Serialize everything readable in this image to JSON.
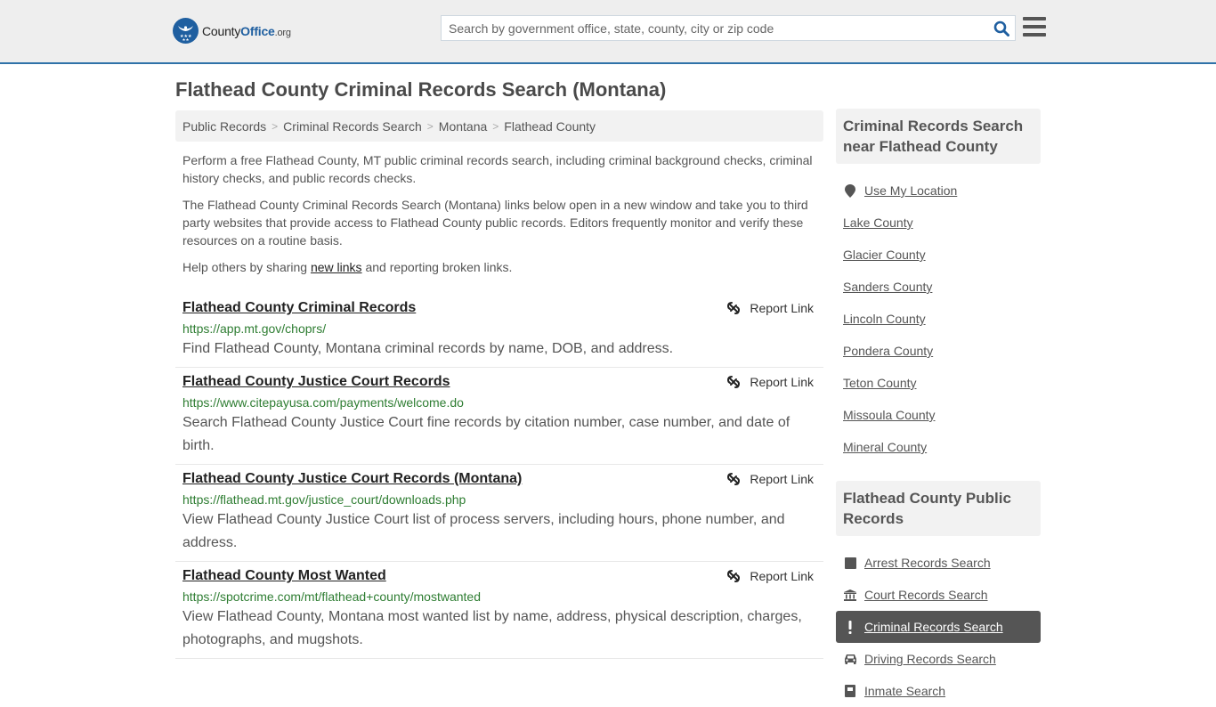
{
  "header": {
    "logo": {
      "prefix": "County",
      "brand": "Office",
      "tld": ".org"
    },
    "search": {
      "placeholder": "Search by government office, state, county, city or zip code",
      "value": ""
    },
    "icons": {
      "search": "search-icon",
      "menu": "hamburger-menu-icon"
    }
  },
  "page": {
    "title": "Flathead County Criminal Records Search (Montana)"
  },
  "breadcrumb": [
    "Public Records",
    "Criminal Records Search",
    "Montana",
    "Flathead County"
  ],
  "intro": {
    "p1": "Perform a free Flathead County, MT public criminal records search, including criminal background checks, criminal history checks, and public records checks.",
    "p2": "The Flathead County Criminal Records Search (Montana) links below open in a new window and take you to third party websites that provide access to Flathead County public records. Editors frequently monitor and verify these resources on a routine basis.",
    "p3_before": "Help others by sharing ",
    "p3_link": "new links",
    "p3_after": " and reporting broken links."
  },
  "records": [
    {
      "title": "Flathead County Criminal Records",
      "url": "https://app.mt.gov/choprs/",
      "description": "Find Flathead County, Montana criminal records by name, DOB, and address.",
      "report_label": "Report Link"
    },
    {
      "title": "Flathead County Justice Court Records",
      "url": "https://www.citepayusa.com/payments/welcome.do",
      "description": "Search Flathead County Justice Court fine records by citation number, case number, and date of birth.",
      "report_label": "Report Link"
    },
    {
      "title": "Flathead County Justice Court Records (Montana)",
      "url": "https://flathead.mt.gov/justice_court/downloads.php",
      "description": "View Flathead County Justice Court list of process servers, including hours, phone number, and address.",
      "report_label": "Report Link"
    },
    {
      "title": "Flathead County Most Wanted",
      "url": "https://spotcrime.com/mt/flathead+county/mostwanted",
      "description": "View Flathead County, Montana most wanted list by name, address, physical description, charges, photographs, and mugshots.",
      "report_label": "Report Link"
    }
  ],
  "sidebar": {
    "nearby": {
      "heading": "Criminal Records Search near Flathead County",
      "use_location": "Use My Location",
      "counties": [
        "Lake County",
        "Glacier County",
        "Sanders County",
        "Lincoln County",
        "Pondera County",
        "Teton County",
        "Missoula County",
        "Mineral County"
      ]
    },
    "public_records": {
      "heading": "Flathead County Public Records",
      "items": [
        {
          "label": "Arrest Records Search",
          "icon": "square-icon",
          "active": false
        },
        {
          "label": "Court Records Search",
          "icon": "courthouse-icon",
          "active": false
        },
        {
          "label": "Criminal Records Search",
          "icon": "exclamation-icon",
          "active": true
        },
        {
          "label": "Driving Records Search",
          "icon": "car-icon",
          "active": false
        },
        {
          "label": "Inmate Search",
          "icon": "inmate-icon",
          "active": false
        }
      ]
    }
  },
  "colors": {
    "accent": "#2f72a8",
    "brand": "#1f5fa0",
    "url_green": "#2e7d32",
    "active_bg": "#555555",
    "header_bg": "#eeeeee"
  }
}
